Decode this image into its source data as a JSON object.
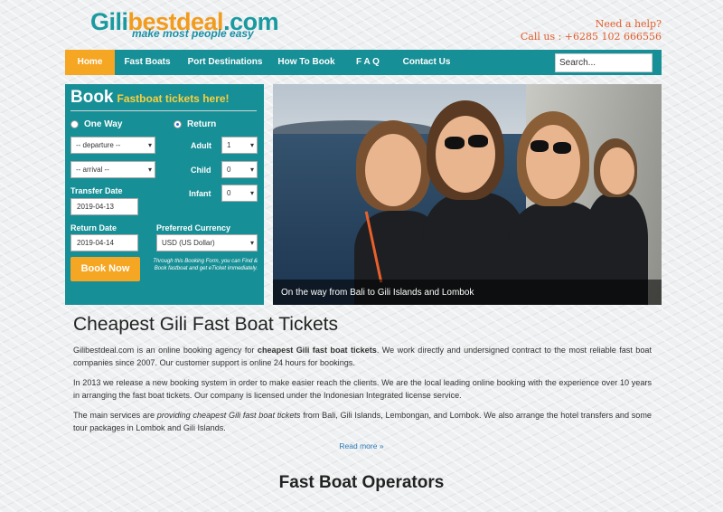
{
  "logo": {
    "part1": "Gili",
    "part2": "bestdeal",
    "part3": ".com",
    "tagline": "make most people easy"
  },
  "help": {
    "line1": "Need a help?",
    "line2": "Call us : +6285 102 666556"
  },
  "nav": {
    "items": [
      "Home",
      "Fast Boats",
      "Port Destinations",
      "How To Book",
      "F A Q",
      "Contact Us"
    ],
    "search_placeholder": "Search..."
  },
  "booking": {
    "title": "Book",
    "subtitle": "Fastboat tickets here!",
    "one_way": "One Way",
    "return": "Return",
    "departure": "-- departure --",
    "arrival": "-- arrival --",
    "adult_label": "Adult",
    "adult_value": "1",
    "child_label": "Child",
    "child_value": "0",
    "infant_label": "Infant",
    "infant_value": "0",
    "transfer_date_label": "Transfer Date",
    "transfer_date": "2019-04-13",
    "return_date_label": "Return Date",
    "return_date": "2019-04-14",
    "currency_label": "Preferred Currency",
    "currency": "USD (US Dollar)",
    "button": "Book Now",
    "note": "Through this Booking Form, you can Find & Book fastboat and get eTicket immediately."
  },
  "hero": {
    "caption": "On the way from Bali to Gili Islands and Lombok"
  },
  "article": {
    "title": "Cheapest Gili Fast Boat Tickets",
    "p1_a": "Gilibestdeal.com is an online booking agency for ",
    "p1_b": "cheapest Gili fast boat tickets",
    "p1_c": ". We work directly and undersigned contract to the most reliable fast boat companies since 2007. Our customer support is online 24 hours for bookings.",
    "p2": "In 2013 we release a new booking system in order to make easier reach the clients. We are the local leading online booking with the experience over 10 years in arranging the fast boat tickets. Our company is licensed under the Indonesian Integrated license service.",
    "p3_a": "The main services are ",
    "p3_b": "providing cheapest Gili fast boat tickets",
    "p3_c": " from Bali, Gili Islands, Lembongan, and Lombok. We also arrange the hotel transfers and some tour packages in Lombok and Gili Islands.",
    "read_more": "Read more »"
  },
  "operators_title": "Fast Boat Operators"
}
